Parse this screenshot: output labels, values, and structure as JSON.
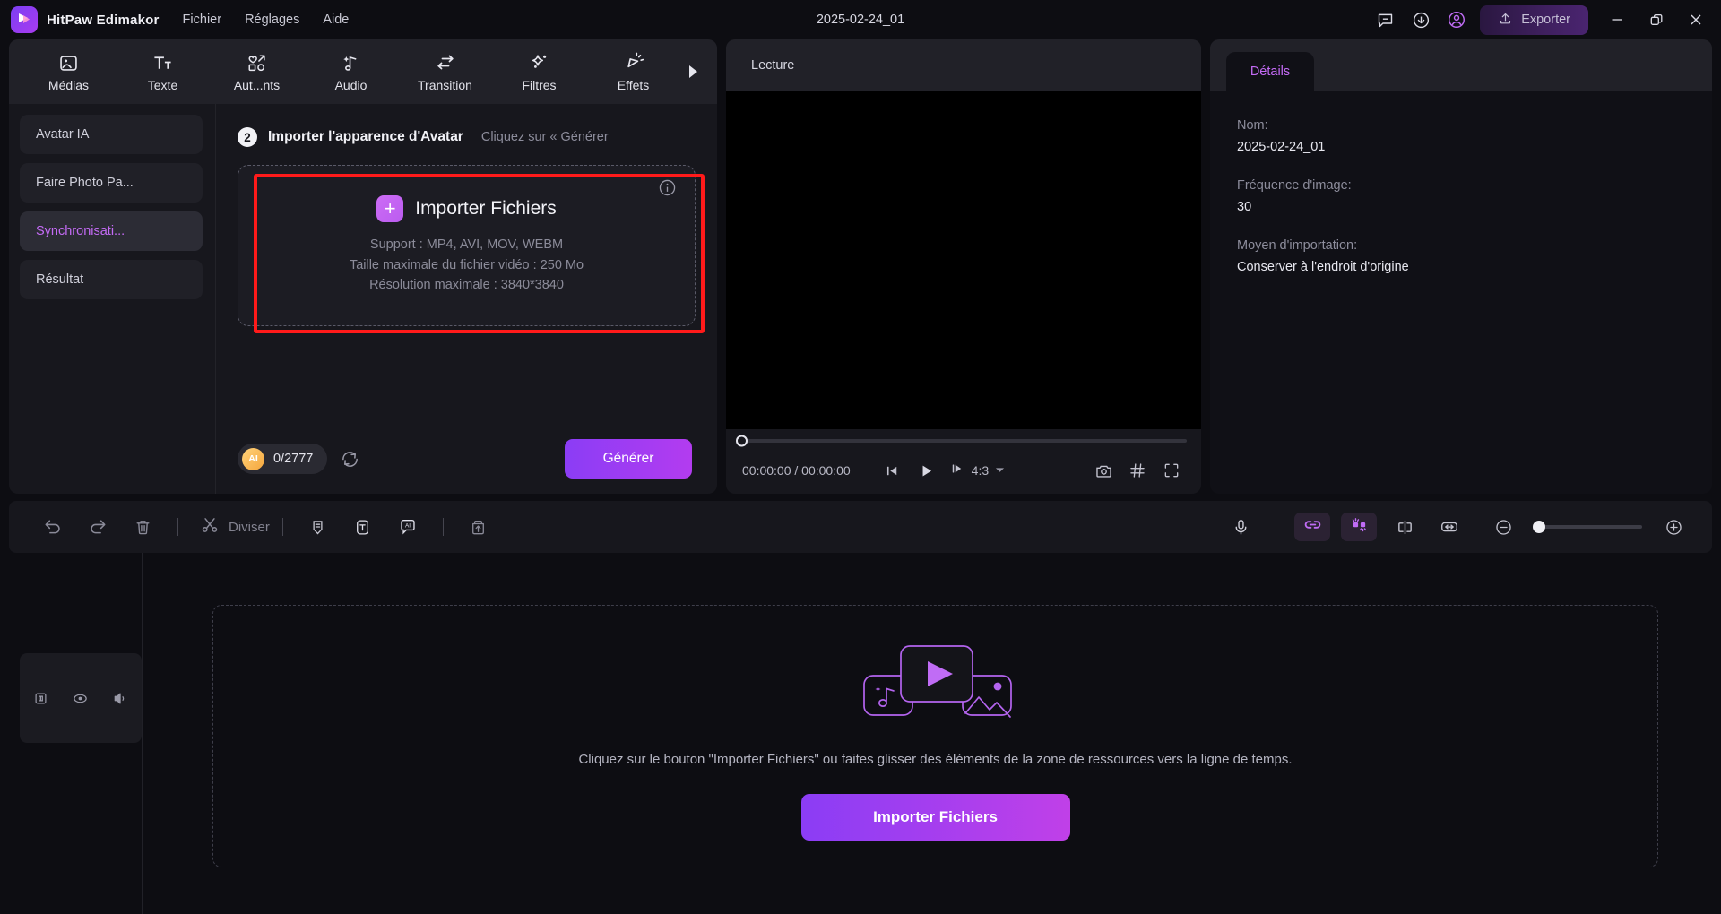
{
  "titlebar": {
    "app_name": "HitPaw Edimakor",
    "menus": [
      "Fichier",
      "Réglages",
      "Aide"
    ],
    "document_title": "2025-02-24_01",
    "export_label": "Exporter",
    "icons": [
      "feedback-icon",
      "download-icon",
      "account-icon"
    ],
    "window_controls": [
      "minimize",
      "restore",
      "close"
    ]
  },
  "tool_tabs": [
    {
      "label": "Médias",
      "icon": "media-icon"
    },
    {
      "label": "Texte",
      "icon": "text-icon"
    },
    {
      "label": "Aut...nts",
      "icon": "elements-icon"
    },
    {
      "label": "Audio",
      "icon": "audio-icon"
    },
    {
      "label": "Transition",
      "icon": "transition-icon"
    },
    {
      "label": "Filtres",
      "icon": "filters-icon"
    },
    {
      "label": "Effets",
      "icon": "effects-icon"
    }
  ],
  "sidebar": {
    "items": [
      {
        "label": "Avatar IA",
        "active": false
      },
      {
        "label": "Faire Photo Pa...",
        "active": false
      },
      {
        "label": "Synchronisati...",
        "active": true
      },
      {
        "label": "Résultat",
        "active": false
      }
    ]
  },
  "import_step": {
    "step_number": "2",
    "title": "Importer l'apparence d'Avatar",
    "hint": "Cliquez sur « Générer",
    "import_button_label": "Importer Fichiers",
    "spec_lines": [
      "Support : MP4, AVI, MOV, WEBM",
      "Taille maximale du fichier vidéo : 250 Mo",
      "Résolution maximale : 3840*3840"
    ],
    "highlight_color": "#ff1a1a",
    "token_badge": "AI",
    "token_count": "0/2777",
    "generate_label": "Générer"
  },
  "preview": {
    "tab_label": "Lecture",
    "time_current": "00:00:00",
    "time_total": "00:00:00",
    "time_display": "00:00:00 / 00:00:00",
    "aspect_ratio": "4:3",
    "progress_percent": 0,
    "controls": [
      "prev-frame-icon",
      "play-icon",
      "next-frame-icon",
      "snapshot-icon",
      "grid-icon",
      "fullscreen-icon"
    ]
  },
  "details": {
    "tab_label": "Détails",
    "fields": [
      {
        "label": "Nom:",
        "value": "2025-02-24_01"
      },
      {
        "label": "Fréquence d'image:",
        "value": "30"
      },
      {
        "label": "Moyen d'importation:",
        "value": "Conserver à l'endroit d'origine"
      }
    ]
  },
  "timeline_toolbar": {
    "split_label": "Diviser",
    "icons": [
      "undo-icon",
      "redo-icon",
      "delete-icon",
      "split-icon",
      "marker-icon",
      "text-box-icon",
      "ai-caption-icon",
      "export-clip-icon",
      "microphone-icon",
      "link-icon",
      "mask-icon",
      "crop-icon",
      "fit-icon"
    ],
    "zoom_out_label": "−",
    "zoom_in_label": "+",
    "zoom_value": 0
  },
  "timeline": {
    "track_icons": [
      "lock-icon",
      "eye-icon",
      "volume-icon"
    ],
    "empty_text": "Cliquez sur le bouton \"Importer Fichiers\" ou faites glisser des éléments de la zone de ressources vers la ligne de temps.",
    "empty_button_label": "Importer Fichiers",
    "accent_color": "#c06cf5"
  }
}
